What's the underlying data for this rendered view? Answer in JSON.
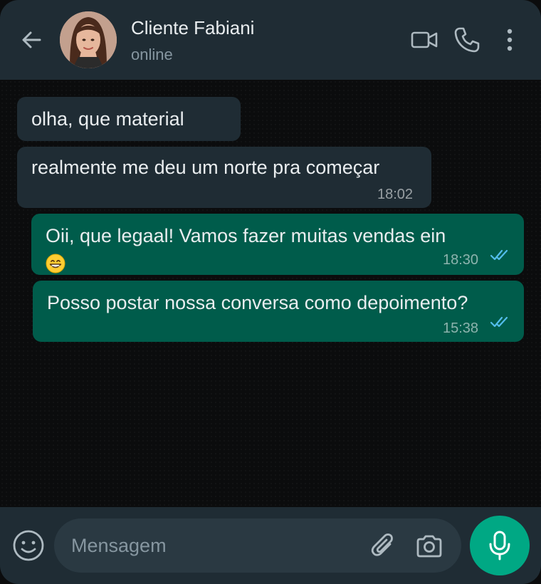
{
  "header": {
    "contact_name": "Cliente Fabiani",
    "status": "online"
  },
  "messages": [
    {
      "direction": "in",
      "text": "olha, que material"
    },
    {
      "direction": "in",
      "text": "realmente me deu um norte pra começar",
      "time": "18:02"
    },
    {
      "direction": "out",
      "text": "Oii, que legaal! Vamos fazer muitas vendas ein",
      "emoji": "grinning-face-with-smiling-eyes",
      "time": "18:30",
      "status": "read"
    },
    {
      "direction": "out",
      "text": "Posso postar nossa conversa como depoimento?",
      "time": "15:38",
      "status": "read"
    }
  ],
  "composer": {
    "placeholder": "Mensagem"
  },
  "colors": {
    "header_bg": "#1f2c34",
    "incoming_bubble": "#1f2c34",
    "outgoing_bubble": "#005c4b",
    "read_ticks": "#53bdeb",
    "accent": "#00a884"
  }
}
